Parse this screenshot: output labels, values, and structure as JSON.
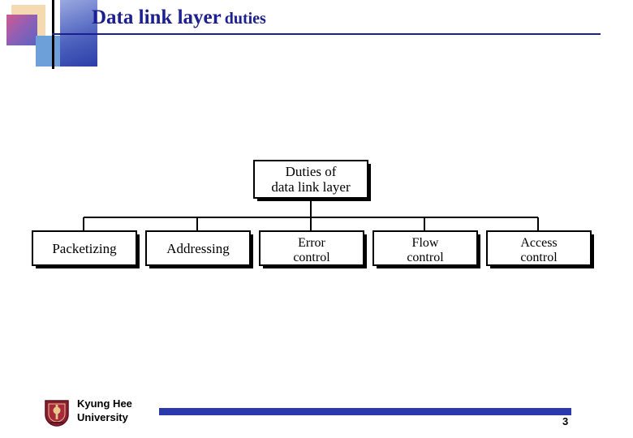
{
  "slide": {
    "title_main": "Data link layer",
    "title_sub": "duties",
    "page_number": "3",
    "accent_color": "#1b1f8f",
    "footer_bar_color": "#2c39ac"
  },
  "footer": {
    "org_line1": "Kyung Hee",
    "org_line2": "University",
    "logo_name": "kyung-hee-university-crest"
  },
  "chart_data": {
    "type": "diagram",
    "title": "Duties of data link layer",
    "root": {
      "line1": "Duties of",
      "line2": "data link layer"
    },
    "children": [
      {
        "line1": "Packetizing",
        "line2": ""
      },
      {
        "line1": "Addressing",
        "line2": ""
      },
      {
        "line1": "Error",
        "line2": "control"
      },
      {
        "line1": "Flow",
        "line2": "control"
      },
      {
        "line1": "Access",
        "line2": "control"
      }
    ],
    "layout": "tree-one-level",
    "box_fill": "#ffffff",
    "box_stroke": "#000000",
    "shadow_color": "#000000"
  }
}
